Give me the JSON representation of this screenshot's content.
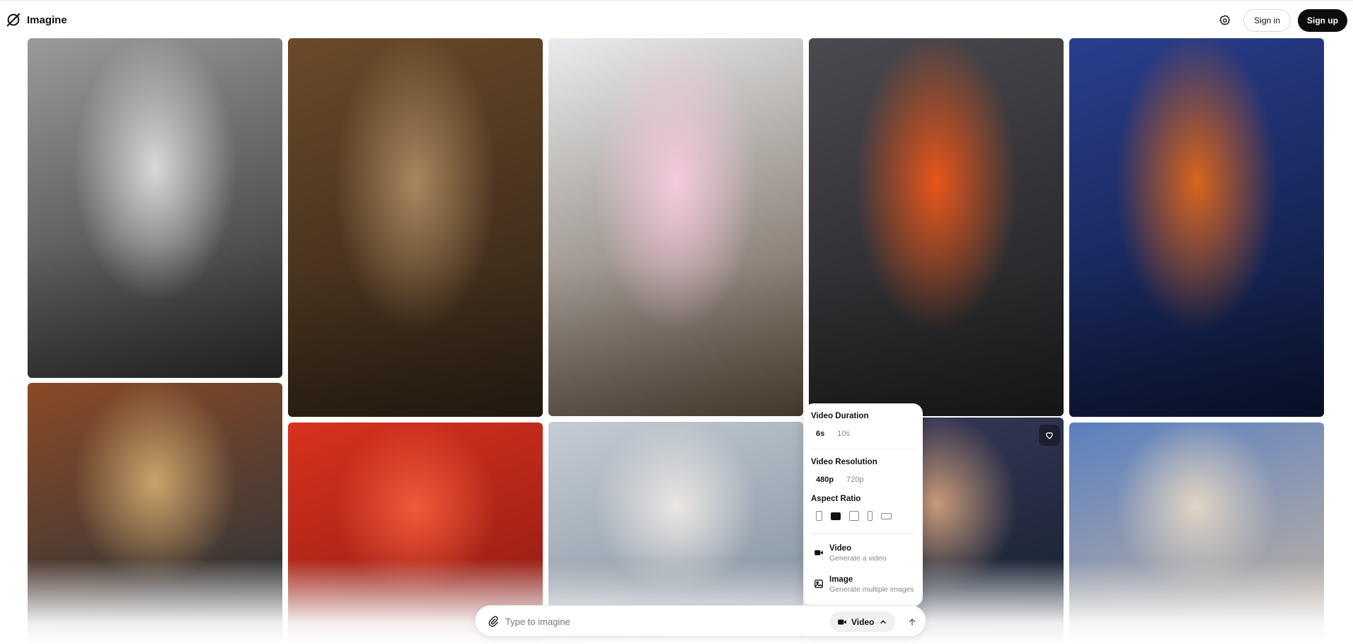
{
  "header": {
    "brand": "Imagine",
    "logo_icon": "imagine-logo-icon",
    "settings_icon": "gear-icon",
    "sign_in": "Sign in",
    "sign_up": "Sign up"
  },
  "gallery": {
    "tiles": [
      {
        "name": "gallery-image-woman-portrait-bw",
        "colors": [
          "#2a2a2a",
          "#9a9a9a",
          "#d8d8d8"
        ]
      },
      {
        "name": "gallery-image-man-office-smoking",
        "colors": [
          "#2b2014",
          "#6b4a2a",
          "#a9865e"
        ]
      },
      {
        "name": "gallery-image-penguin-tutu",
        "colors": [
          "#5c4a3a",
          "#e9ecef",
          "#f4c9dc"
        ]
      },
      {
        "name": "gallery-image-lava-volcano",
        "colors": [
          "#1c1c1e",
          "#4a4a50",
          "#e8561a"
        ]
      },
      {
        "name": "gallery-image-anime-latex-woman",
        "colors": [
          "#0a1430",
          "#2a3f8f",
          "#d9651c"
        ]
      },
      {
        "name": "gallery-image-redhead-bubbles",
        "colors": [
          "#23323d",
          "#8a4a26",
          "#c9a36a"
        ]
      },
      {
        "name": "gallery-image-red-sun-rider",
        "colors": [
          "#8b1a14",
          "#d8321e",
          "#f15a3a"
        ]
      },
      {
        "name": "gallery-image-cello-player",
        "colors": [
          "#7d8c9c",
          "#c4ccd4",
          "#eae6e2"
        ]
      },
      {
        "name": "gallery-image-woman-hat-street",
        "colors": [
          "#14202e",
          "#3a3a5a",
          "#c89a7a"
        ]
      },
      {
        "name": "gallery-image-glass-sculpture",
        "colors": [
          "#c9b7a2",
          "#5a7fbf",
          "#e0d4c4"
        ]
      }
    ],
    "favorite_icon": "heart-icon"
  },
  "settings": {
    "duration": {
      "title": "Video Duration",
      "options": [
        "6s",
        "10s"
      ],
      "selected": "6s"
    },
    "resolution": {
      "title": "Video Resolution",
      "options": [
        "480p",
        "720p"
      ],
      "selected": "480p"
    },
    "aspect": {
      "title": "Aspect Ratio",
      "options": [
        "portrait-2-3-icon",
        "landscape-3-2-icon",
        "square-1-1-icon",
        "portrait-9-16-icon",
        "landscape-16-9-icon"
      ],
      "selected": "landscape-3-2-icon"
    },
    "modes": [
      {
        "title": "Video",
        "subtitle": "Generate a video",
        "icon": "video-camera-icon"
      },
      {
        "title": "Image",
        "subtitle": "Generate multiple images",
        "icon": "image-icon"
      }
    ]
  },
  "prompt": {
    "placeholder": "Type to imagine",
    "value": "",
    "attach_icon": "paperclip-icon",
    "mode_label": "Video",
    "mode_icon": "video-camera-icon",
    "chevron_icon": "chevron-up-icon",
    "send_icon": "arrow-up-icon"
  }
}
